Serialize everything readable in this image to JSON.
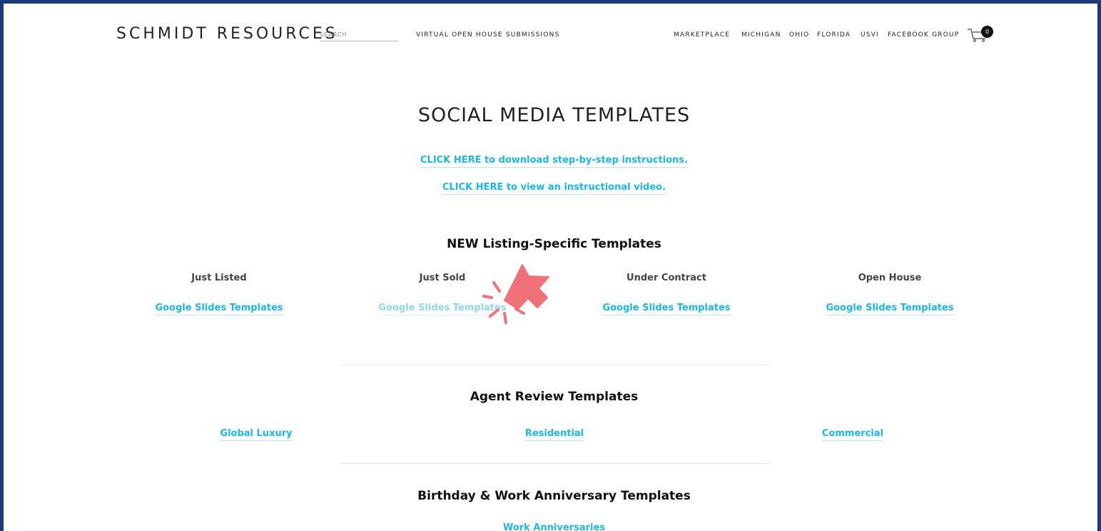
{
  "header": {
    "brand": "SCHMIDT RESOURCES",
    "search_placeholder": "SEARCH",
    "left_nav": [
      "VIRTUAL OPEN HOUSE SUBMISSIONS"
    ],
    "right_nav": [
      "MARKETPLACE",
      "MICHIGAN",
      "OHIO",
      "FLORIDA",
      "USVI",
      "FACEBOOK GROUP"
    ],
    "cart_count": "0",
    "cart_icon": "cart-icon"
  },
  "main": {
    "title": "SOCIAL MEDIA TEMPLATES",
    "instruction_links": [
      "CLICK HERE to download step-by-step instructions.",
      "CLICK HERE to view an instructional video."
    ],
    "listing_section": {
      "heading": "NEW Listing-Specific Templates",
      "columns": [
        {
          "label": "Just Listed",
          "link": "Google Slides Templates"
        },
        {
          "label": "Just Sold",
          "link": "Google Slides Templates"
        },
        {
          "label": "Under Contract",
          "link": "Google Slides Templates"
        },
        {
          "label": "Open House",
          "link": "Google Slides Templates"
        }
      ]
    },
    "review_section": {
      "heading": "Agent Review Templates",
      "links": [
        "Global Luxury",
        "Residential",
        "Commercial"
      ]
    },
    "birthday_section": {
      "heading": "Birthday & Work Anniversary Templates",
      "links": [
        "Work Anniversaries"
      ]
    }
  },
  "overlay": {
    "pointer_icon": "click-pointer-icon",
    "pointer_color": "#f07178"
  },
  "colors": {
    "border": "#1a3a7a",
    "link": "#1ab8ea"
  }
}
